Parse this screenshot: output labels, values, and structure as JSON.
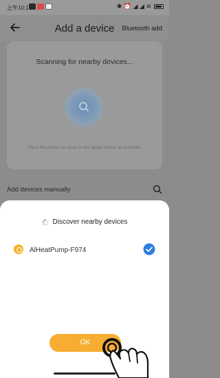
{
  "status_bar": {
    "time": "上午10:10",
    "app_icon_colors": [
      "#2b2b2b",
      "#e04a4a",
      "#f0f0f0"
    ],
    "right_glyphs": "✱ ⏰ ◢ ◢ ≋"
  },
  "header": {
    "title": "Add a device",
    "bluetooth_add": "Bluetooth add"
  },
  "scan": {
    "status": "Scanning for nearby devices...",
    "hint": "Place the phone as close to the target device as possible."
  },
  "manual": {
    "label": "Add devices manually"
  },
  "sheet": {
    "title": "Discover nearby devices",
    "devices": [
      {
        "name": "AlHeatPump-F974",
        "selected": true,
        "icon": "device-icon"
      }
    ],
    "ok_label": "OK"
  },
  "colors": {
    "accent": "#f6ad32",
    "check": "#2d7fe0",
    "overlay": "#8c8c8c",
    "device_icon": "#f4b42a"
  }
}
